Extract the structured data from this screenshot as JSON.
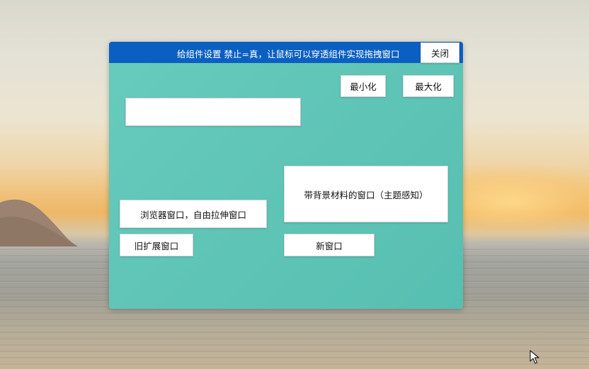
{
  "window": {
    "title": "给组件设置 禁止=真，让鼠标可以穿透组件实现拖拽窗口",
    "close_label": "关闭",
    "minimize_label": "最小化",
    "maximize_label": "最大化",
    "text_input_value": "",
    "material_window_label": "带背景材料的窗口（主题感知）",
    "browser_window_label": "浏览器窗口，自由拉伸窗口",
    "legacy_extended_label": "旧扩展窗口",
    "new_window_label": "新窗口"
  },
  "colors": {
    "titlebar": "#0b5fc1",
    "window_bg": "#5ec4b6",
    "button_bg": "#ffffff"
  },
  "icons": {
    "cursor": "mouse-pointer-icon"
  }
}
